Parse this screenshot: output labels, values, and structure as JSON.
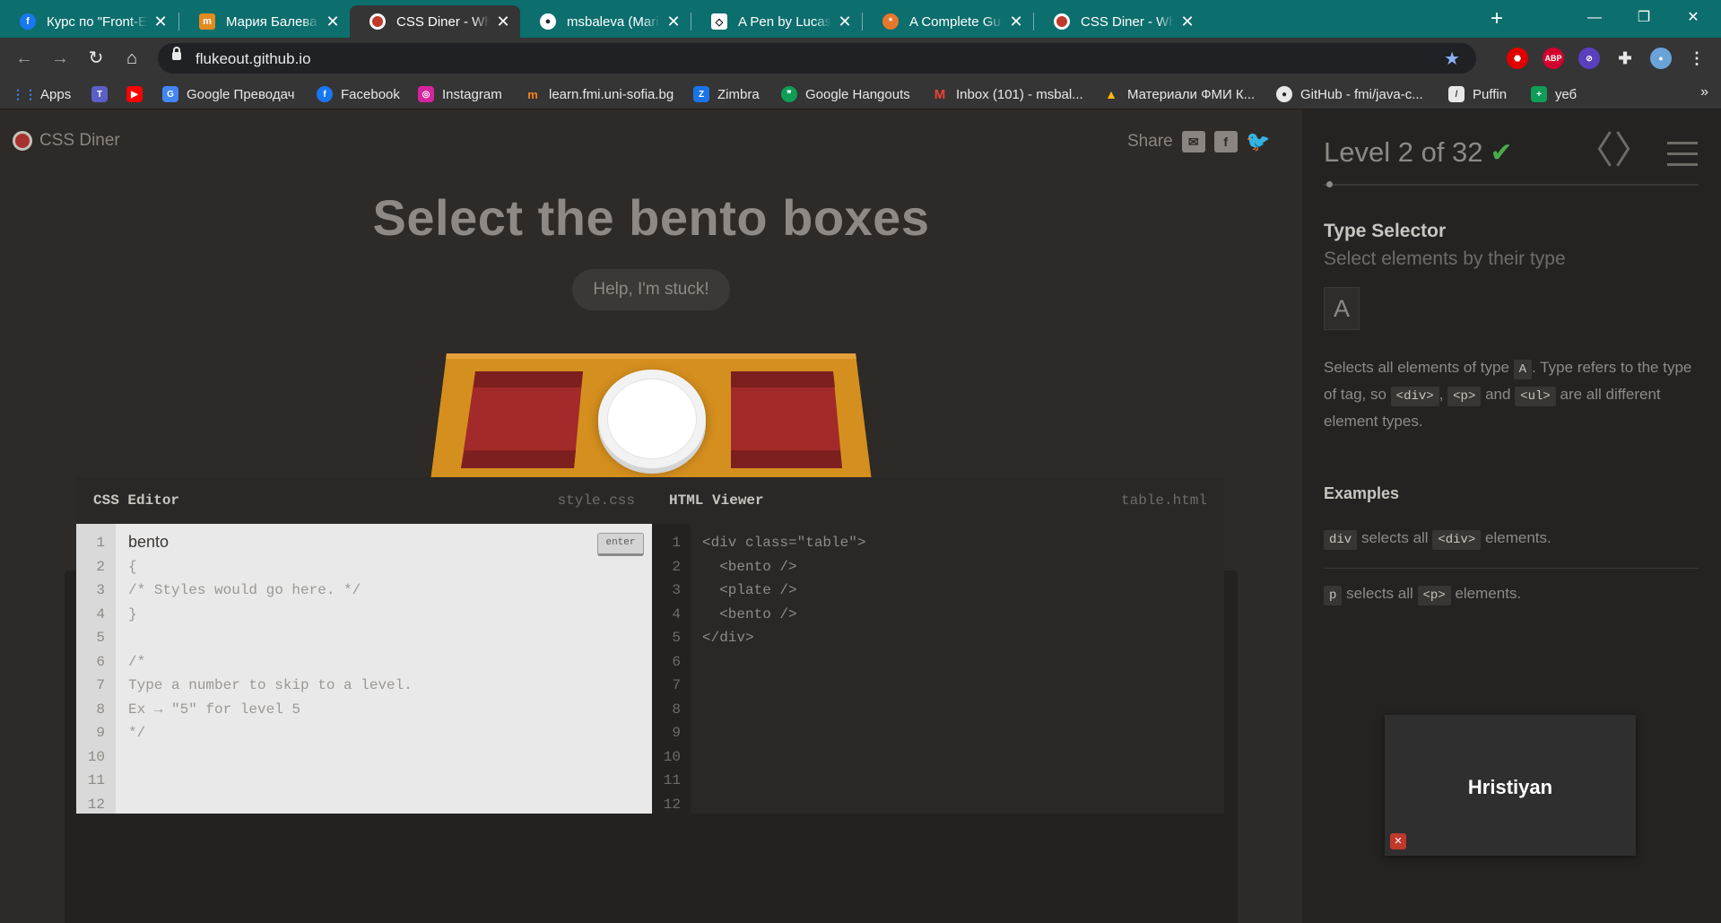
{
  "browser": {
    "tabs": [
      {
        "label": "Курс по \"Front-End We",
        "icon": "facebook-icon",
        "color": "#1877f2",
        "active": false
      },
      {
        "label": "Мария Балева: Публи",
        "icon": "learn-icon",
        "color": "#e38b1e",
        "active": false
      },
      {
        "label": "CSS Diner - Where we f",
        "icon": "css-diner-icon",
        "color": "#c0392b",
        "active": true
      },
      {
        "label": "msbaleva (Maria Balev",
        "icon": "github-icon",
        "color": "#24292e",
        "active": false
      },
      {
        "label": "A Pen by Lucas Chen",
        "icon": "codepen-icon",
        "color": "#000000",
        "active": false
      },
      {
        "label": "A Complete Guide to F",
        "icon": "css-tricks-icon",
        "color": "#e8772e",
        "active": false
      },
      {
        "label": "CSS Diner - Where we f",
        "icon": "css-diner-icon",
        "color": "#c0392b",
        "active": false
      }
    ],
    "close_glyph": "✕",
    "new_tab_glyph": "+",
    "window_controls": {
      "minimize": "—",
      "restore": "❐",
      "close": "✕"
    },
    "url": "flukeout.github.io",
    "bookmarks": [
      {
        "label": "Apps",
        "icon": "apps-grid-icon",
        "color": "#4285f4"
      },
      {
        "label": "",
        "icon": "teams-icon",
        "color": "#5b5fc7"
      },
      {
        "label": "",
        "icon": "youtube-icon",
        "color": "#ff0000"
      },
      {
        "label": "Google Преводач",
        "icon": "google-translate-icon",
        "color": "#4285f4"
      },
      {
        "label": "Facebook",
        "icon": "facebook-icon",
        "color": "#1877f2"
      },
      {
        "label": "Instagram",
        "icon": "instagram-icon",
        "color": "#d6249f"
      },
      {
        "label": "learn.fmi.uni-sofia.bg",
        "icon": "moodle-icon",
        "color": "#f98012"
      },
      {
        "label": "Zimbra",
        "icon": "zimbra-icon",
        "color": "#1a73e8"
      },
      {
        "label": "Google Hangouts",
        "icon": "hangouts-icon",
        "color": "#0f9d58"
      },
      {
        "label": "Inbox (101) - msbal...",
        "icon": "gmail-icon",
        "color": "#ea4335"
      },
      {
        "label": "Материали ФМИ К...",
        "icon": "google-drive-icon",
        "color": "#fbbc04"
      },
      {
        "label": "GitHub - fmi/java-c...",
        "icon": "github-icon",
        "color": "#ffffff"
      },
      {
        "label": "Puffin",
        "icon": "puffin-icon",
        "color": "#e8e8e8"
      },
      {
        "label": "уеб",
        "icon": "plus-bookmark-icon",
        "color": "#0f9d58"
      }
    ],
    "more_glyph": "»"
  },
  "page": {
    "logo_text": "CSS Diner",
    "share_label": "Share",
    "order": "Select the bento boxes",
    "help_label": "Help, I'm stuck!",
    "css_editor": {
      "title": "CSS Editor",
      "file": "style.css",
      "input_value": "bento",
      "enter_label": "enter",
      "lines": [
        "1",
        "2",
        "3",
        "4",
        "5",
        "6",
        "7",
        "8",
        "9",
        "10",
        "11",
        "12"
      ],
      "code": [
        "",
        "{",
        "/* Styles would go here. */",
        "}",
        "",
        "/*",
        "Type a number to skip to a level.",
        "Ex → \"5\" for level 5",
        "*/",
        "",
        "",
        ""
      ]
    },
    "html_viewer": {
      "title": "HTML Viewer",
      "file": "table.html",
      "lines": [
        "1",
        "2",
        "3",
        "4",
        "5",
        "6",
        "7",
        "8",
        "9",
        "10",
        "11",
        "12"
      ],
      "code": [
        "<div class=\"table\">",
        "  <bento />",
        "  <plate />",
        "  <bento />",
        "</div>",
        "",
        "",
        "",
        "",
        "",
        "",
        ""
      ]
    }
  },
  "sidebar": {
    "level_text": "Level 2 of 32",
    "completed_glyph": "✔",
    "prev_glyph": "〈",
    "next_glyph": "〉",
    "selector_name": "Type Selector",
    "title": "Select elements by their type",
    "syntax": "A",
    "hint": {
      "p1": "Selects all elements of type ",
      "tag_a": "A",
      "p2": ". Type refers to the type of tag, so ",
      "tag_div": "<div>",
      "p3": ", ",
      "tag_p": "<p>",
      "p4": " and ",
      "tag_ul": "<ul>",
      "p5": " are all different element types."
    },
    "examples_label": "Examples",
    "examples": [
      {
        "selector": "div",
        "mid": " selects all ",
        "tag": "<div>",
        "end": " elements."
      },
      {
        "selector": "p",
        "mid": " selects all ",
        "tag": "<p>",
        "end": " elements."
      }
    ]
  },
  "video_call": {
    "name": "Hristiyan"
  },
  "colors": {
    "accent_teal": "#0d6e6e",
    "table": "#d58f1e",
    "bento": "#a32a2a",
    "check_green": "#4aaa4a"
  }
}
